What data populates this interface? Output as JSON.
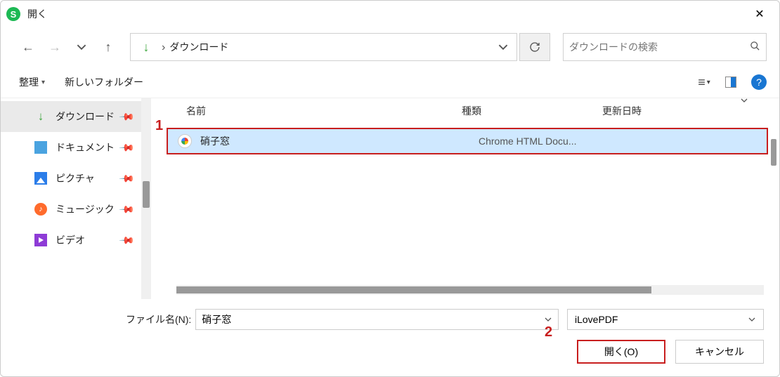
{
  "window": {
    "title": "開く"
  },
  "nav": {
    "path_label": "ダウンロード"
  },
  "search": {
    "placeholder": "ダウンロードの検索"
  },
  "toolbar": {
    "organize": "整理",
    "new_folder": "新しいフォルダー"
  },
  "sidebar": {
    "items": [
      {
        "label": "ダウンロード"
      },
      {
        "label": "ドキュメント"
      },
      {
        "label": "ピクチャ"
      },
      {
        "label": "ミュージック"
      },
      {
        "label": "ビデオ"
      }
    ]
  },
  "columns": {
    "name": "名前",
    "type": "種類",
    "date": "更新日時"
  },
  "files": [
    {
      "name": "硝子窓",
      "type": "Chrome HTML Docu..."
    }
  ],
  "footer": {
    "filename_label": "ファイル名(N):",
    "filename_value": "硝子窓",
    "filter_value": "iLovePDF",
    "open": "開く(O)",
    "cancel": "キャンセル"
  },
  "annotations": {
    "one": "1",
    "two": "2"
  }
}
